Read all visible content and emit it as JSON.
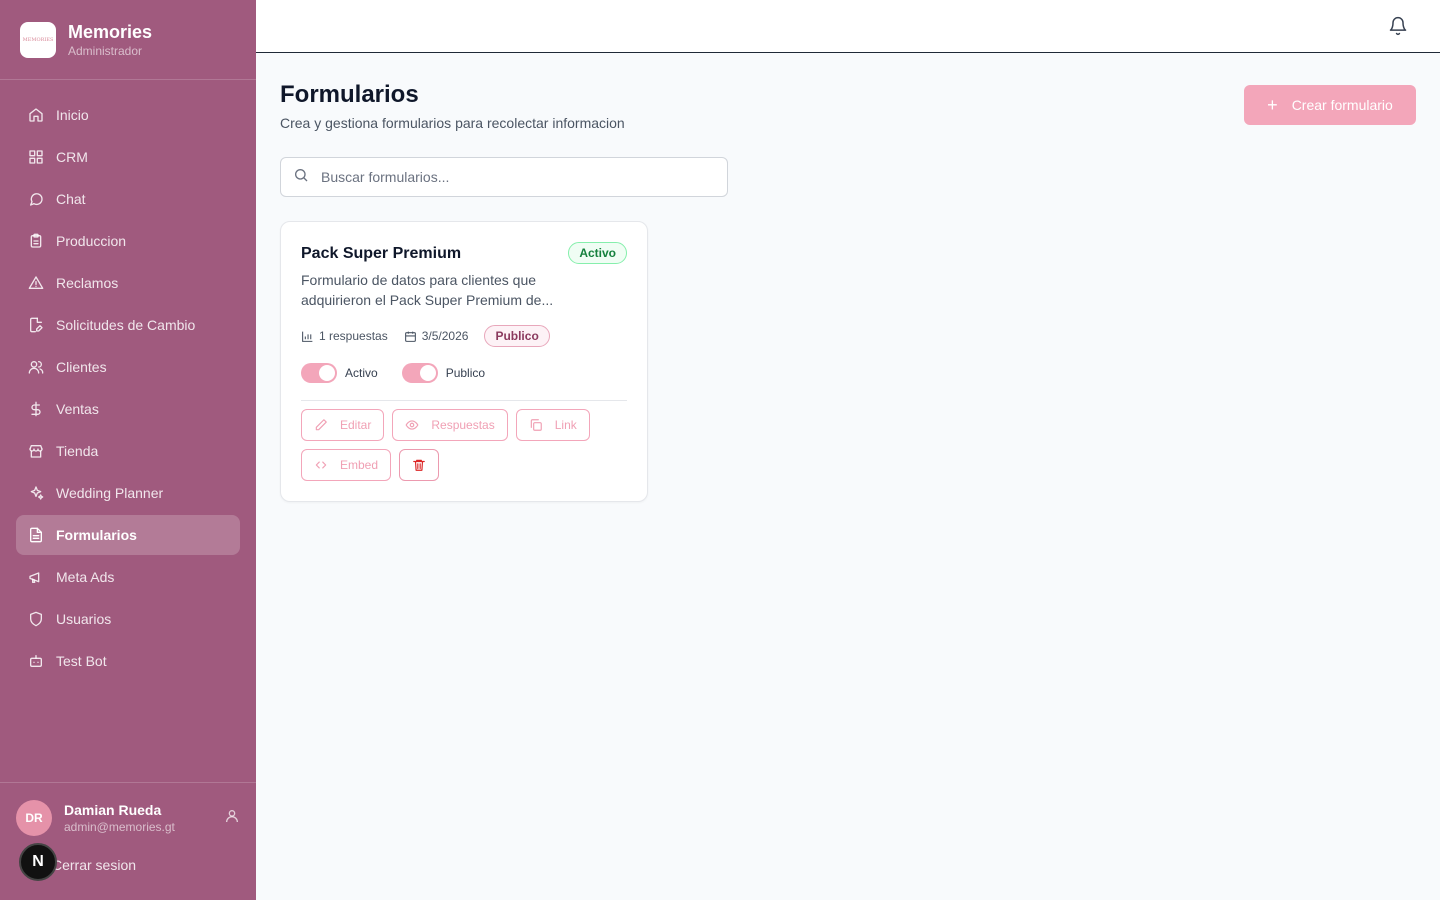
{
  "brand": {
    "name": "Memories",
    "role": "Administrador",
    "logo_text": "MEMORIES"
  },
  "nav": [
    {
      "label": "Inicio",
      "icon": "home-icon"
    },
    {
      "label": "CRM",
      "icon": "grid-icon"
    },
    {
      "label": "Chat",
      "icon": "chat-icon"
    },
    {
      "label": "Produccion",
      "icon": "clipboard-icon"
    },
    {
      "label": "Reclamos",
      "icon": "warning-icon"
    },
    {
      "label": "Solicitudes de Cambio",
      "icon": "file-edit-icon"
    },
    {
      "label": "Clientes",
      "icon": "users-icon"
    },
    {
      "label": "Ventas",
      "icon": "dollar-icon"
    },
    {
      "label": "Tienda",
      "icon": "store-icon"
    },
    {
      "label": "Wedding Planner",
      "icon": "sparkles-icon"
    },
    {
      "label": "Formularios",
      "icon": "file-text-icon",
      "active": true
    },
    {
      "label": "Meta Ads",
      "icon": "megaphone-icon"
    },
    {
      "label": "Usuarios",
      "icon": "shield-icon"
    },
    {
      "label": "Test Bot",
      "icon": "bot-icon"
    }
  ],
  "user": {
    "initials": "DR",
    "name": "Damian Rueda",
    "email": "admin@memories.gt",
    "logout_label": "Cerrar sesion"
  },
  "next_badge": "N",
  "page": {
    "title": "Formularios",
    "subtitle": "Crea y gestiona formularios para recolectar informacion",
    "create_label": "Crear formulario",
    "search_placeholder": "Buscar formularios..."
  },
  "form_card": {
    "title": "Pack Super Premium",
    "status": "Activo",
    "description": "Formulario de datos para clientes que adquirieron el Pack Super Premium de...",
    "responses": "1 respuestas",
    "date": "3/5/2026",
    "visibility": "Publico",
    "toggle_active_label": "Activo",
    "toggle_public_label": "Publico",
    "actions": {
      "edit": "Editar",
      "responses": "Respuestas",
      "link": "Link",
      "embed": "Embed"
    }
  },
  "colors": {
    "sidebar": "#a05a7e",
    "accent": "#f3a6ba",
    "success": "#15803d"
  }
}
